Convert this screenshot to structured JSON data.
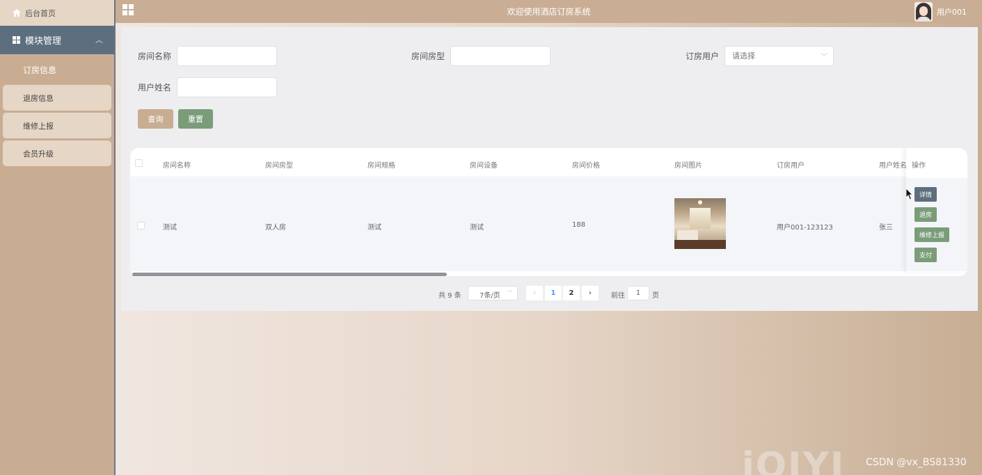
{
  "header": {
    "title": "欢迎使用酒店订房系统",
    "username": "用户001"
  },
  "sidebar": {
    "home": "后台首页",
    "module": "模块管理",
    "items": [
      {
        "label": "订房信息",
        "active": true
      },
      {
        "label": "退房信息",
        "active": false
      },
      {
        "label": "维修上报",
        "active": false
      },
      {
        "label": "会员升级",
        "active": false
      }
    ]
  },
  "search": {
    "room_name_label": "房间名称",
    "room_type_label": "房间房型",
    "booking_user_label": "订房用户",
    "booking_user_placeholder": "请选择",
    "user_name_label": "用户姓名",
    "query_button": "查询",
    "reset_button": "重置"
  },
  "table": {
    "columns": [
      "房间名称",
      "房间房型",
      "房间规格",
      "房间设备",
      "房间价格",
      "房间图片",
      "订房用户",
      "用户姓名"
    ],
    "action_header": "操作",
    "rows": [
      {
        "room_name": "测试",
        "room_type": "双人房",
        "room_spec": "测试",
        "room_equipment": "测试",
        "room_price": "188",
        "booking_user": "用户001-123123",
        "user_name": "张三"
      }
    ],
    "actions": {
      "detail": "详情",
      "checkout": "退房",
      "repair": "维修上报",
      "pay": "支付"
    }
  },
  "pagination": {
    "total_text": "共 9 条",
    "page_size": "7条/页",
    "pages": [
      "1",
      "2"
    ],
    "current_page": "1",
    "goto_text": "前往",
    "goto_value": "1",
    "page_word": "页"
  },
  "watermark": {
    "iqiyi": "iQIYI",
    "csdn": "CSDN @vx_BS81330"
  }
}
